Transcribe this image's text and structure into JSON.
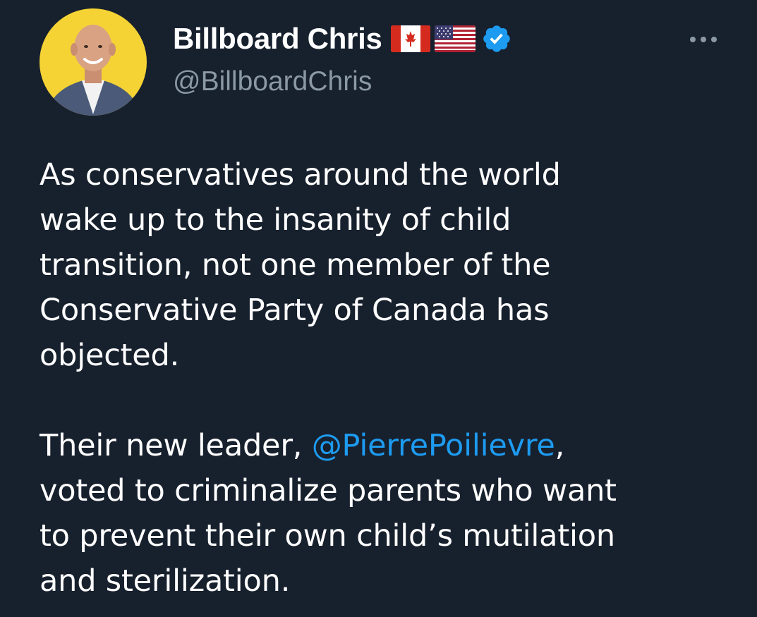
{
  "author": {
    "display_name": "Billboard Chris",
    "handle": "@BillboardChris",
    "flags": [
      "canada-flag-icon",
      "usa-flag-icon"
    ],
    "verified_icon": "verified-badge-icon",
    "avatar_background": "#f5d335"
  },
  "more_icon": "more-options-icon",
  "tweet": {
    "paragraph1": {
      "lines": [
        "As conservatives around the world",
        "wake up to the insanity of child",
        "transition, not one member of the",
        "Conservative Party of Canada has",
        "objected."
      ]
    },
    "paragraph2": {
      "line1_prefix": "Their new leader, ",
      "mention": "@PierrePoilievre",
      "line1_suffix": ",",
      "lines": [
        "voted to criminalize parents who want",
        "to prevent their own child’s mutilation",
        "and sterilization."
      ]
    }
  },
  "colors": {
    "background": "#17202d",
    "text": "#ffffff",
    "secondary_text": "#8b98a5",
    "accent": "#1d9bf0"
  }
}
